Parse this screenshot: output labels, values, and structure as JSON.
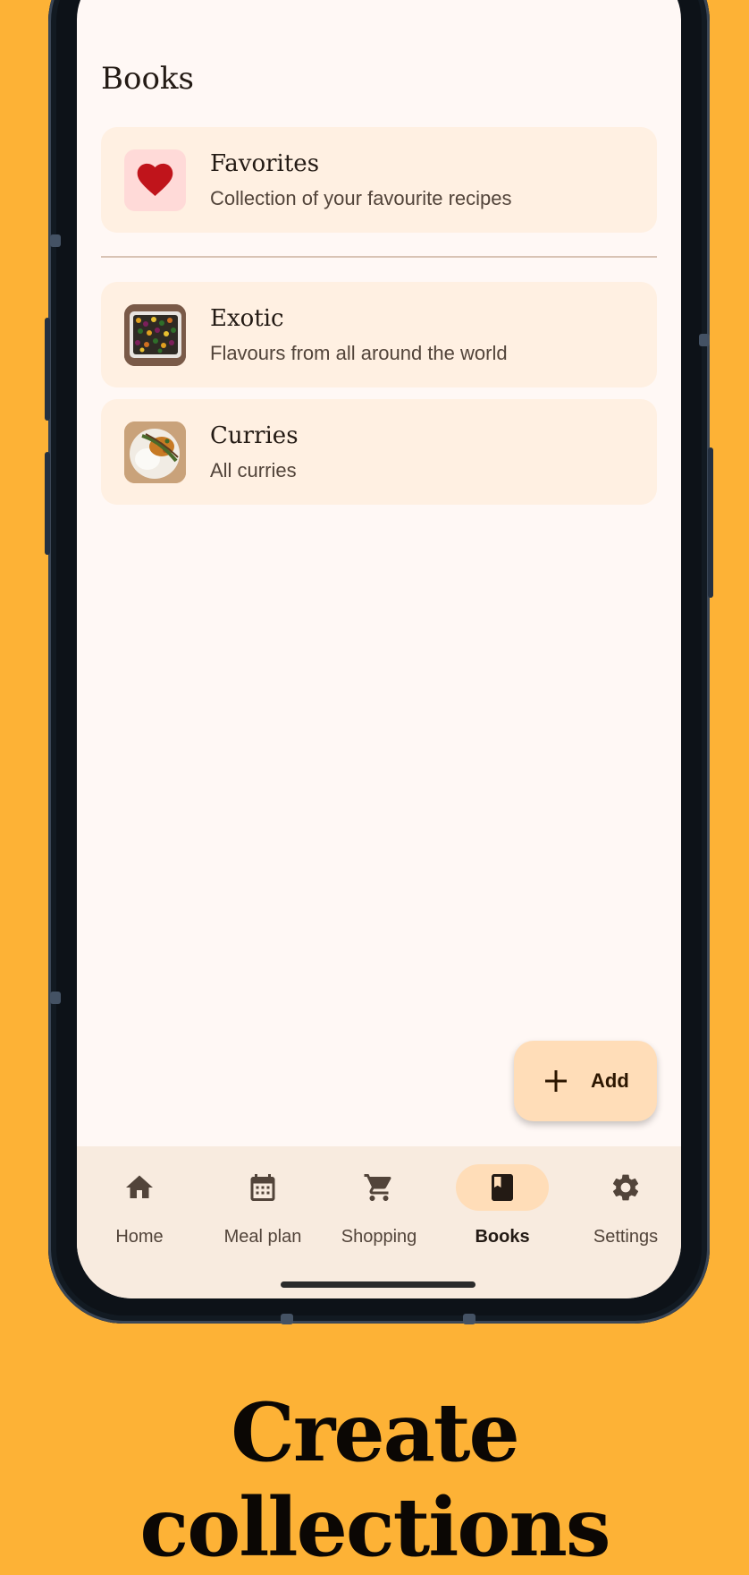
{
  "app": {
    "page_title": "Books"
  },
  "books": [
    {
      "title": "Favorites",
      "subtitle": "Collection of your favourite recipes",
      "thumbnail": "heart-icon"
    },
    {
      "title": "Exotic",
      "subtitle": "Flavours from all around the world",
      "thumbnail": "exotic-dish-photo"
    },
    {
      "title": "Curries",
      "subtitle": "All curries",
      "thumbnail": "curry-dish-photo"
    }
  ],
  "fab": {
    "label": "Add",
    "icon": "plus-icon"
  },
  "nav": {
    "items": [
      {
        "label": "Home",
        "icon": "home-icon",
        "active": false
      },
      {
        "label": "Meal plan",
        "icon": "calendar-icon",
        "active": false
      },
      {
        "label": "Shopping",
        "icon": "cart-icon",
        "active": false
      },
      {
        "label": "Books",
        "icon": "book-icon",
        "active": true
      },
      {
        "label": "Settings",
        "icon": "gear-icon",
        "active": false
      }
    ]
  },
  "caption": "Create collections",
  "colors": {
    "background": "#FDB236",
    "surface": "#FFF8F5",
    "card": "#FFF0E2",
    "accent_container": "#FFDDB8",
    "heart": "#C0141B",
    "heart_bg": "#FFDAD8"
  }
}
